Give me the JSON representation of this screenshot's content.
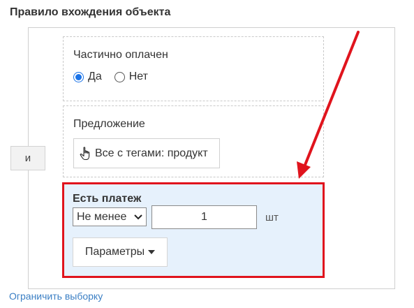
{
  "section": {
    "title": "Правило вхождения объекта"
  },
  "logic": {
    "and_label": "и"
  },
  "partial_paid": {
    "label": "Частично оплачен",
    "options": [
      {
        "label": "Да",
        "checked": true
      },
      {
        "label": "Нет",
        "checked": false
      }
    ]
  },
  "offer": {
    "label": "Предложение",
    "button_label": "Все с тегами: продукт",
    "icon": "hand-pointer-icon"
  },
  "payment": {
    "title": "Есть платеж",
    "comparator": "Не менее",
    "value": "1",
    "unit": "шт",
    "params_label": "Параметры"
  },
  "footer": {
    "limit_link": "Ограничить выборку"
  },
  "colors": {
    "highlight": "#e0141d",
    "accent": "#1a73e8",
    "link": "#3b7fc4",
    "payment_bg": "#e6f1fc"
  }
}
